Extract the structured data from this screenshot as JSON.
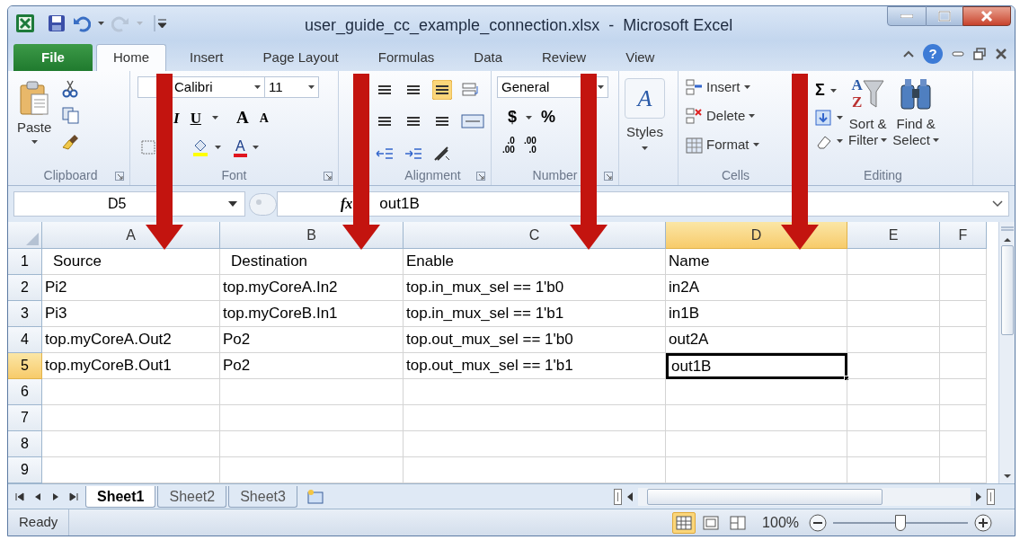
{
  "window": {
    "title": "user_guide_cc_example_connection.xlsx  -  Microsoft Excel"
  },
  "tabs": [
    {
      "label": "File",
      "kind": "file",
      "selected": false
    },
    {
      "label": "Home",
      "kind": "tab",
      "selected": true
    },
    {
      "label": "Insert",
      "kind": "tab",
      "selected": false
    },
    {
      "label": "Page Layout",
      "kind": "tab",
      "selected": false
    },
    {
      "label": "Formulas",
      "kind": "tab",
      "selected": false
    },
    {
      "label": "Data",
      "kind": "tab",
      "selected": false
    },
    {
      "label": "Review",
      "kind": "tab",
      "selected": false
    },
    {
      "label": "View",
      "kind": "tab",
      "selected": false
    }
  ],
  "ribbon": {
    "clipboard": {
      "paste": "Paste",
      "label": "Clipboard"
    },
    "help": "?",
    "font": {
      "name": "Calibri",
      "size": "11",
      "italic": "I",
      "underline": "U",
      "grow": "A",
      "shrink": "A",
      "color_glyph": "A",
      "label": "Font"
    },
    "alignment": {
      "label": "Alignment"
    },
    "number": {
      "format": "General",
      "currency": "$",
      "percent": "%",
      "increase": [
        ".0",
        ".00"
      ],
      "decrease": [
        ".00",
        ".0"
      ],
      "label": "Number"
    },
    "styles": {
      "glyph": "A",
      "label": "Styles"
    },
    "cells": {
      "items": [
        "Insert",
        "Delete",
        "Format"
      ],
      "label": "Cells"
    },
    "editing": {
      "sum": "Σ",
      "sort_glyphs": [
        "A",
        "Z"
      ],
      "sort": [
        "Sort &",
        "Filter"
      ],
      "find": [
        "Find &",
        "Select"
      ],
      "label": "Editing"
    }
  },
  "formula_bar": {
    "name_box": "D5",
    "fx": "fx",
    "formula": "out1B"
  },
  "sheet": {
    "columns": [
      {
        "label": "A",
        "selected": false
      },
      {
        "label": "B",
        "selected": false
      },
      {
        "label": "C",
        "selected": false
      },
      {
        "label": "D",
        "selected": true
      },
      {
        "label": "E",
        "selected": false
      },
      {
        "label": "F",
        "selected": false
      }
    ],
    "rows": [
      {
        "number": "1",
        "selected": false,
        "cells": [
          "Source",
          "Destination",
          "Enable",
          "Name"
        ]
      },
      {
        "number": "2",
        "selected": false,
        "cells": [
          "Pi2",
          "top.myCoreA.In2",
          "top.in_mux_sel == 1'b0",
          "in2A"
        ]
      },
      {
        "number": "3",
        "selected": false,
        "cells": [
          "Pi3",
          "top.myCoreB.In1",
          "top.in_mux_sel == 1'b1",
          "in1B"
        ]
      },
      {
        "number": "4",
        "selected": false,
        "cells": [
          "top.myCoreA.Out2",
          "Po2",
          "top.out_mux_sel == 1'b0",
          "out2A"
        ]
      },
      {
        "number": "5",
        "selected": true,
        "cells": [
          "top.myCoreB.Out1",
          "Po2",
          "top.out_mux_sel == 1'b1",
          "out1B"
        ]
      },
      {
        "number": "6",
        "selected": false,
        "cells": []
      },
      {
        "number": "7",
        "selected": false,
        "cells": []
      },
      {
        "number": "8",
        "selected": false,
        "cells": []
      },
      {
        "number": "9",
        "selected": false,
        "cells": []
      }
    ]
  },
  "sheet_tabs": [
    {
      "label": "Sheet1",
      "selected": true
    },
    {
      "label": "Sheet2",
      "selected": false
    },
    {
      "label": "Sheet3",
      "selected": false
    }
  ],
  "status_bar": {
    "status": "Ready",
    "views": [
      {
        "kind": "normal",
        "selected": true
      },
      {
        "kind": "layout",
        "selected": false
      },
      {
        "kind": "pagebreak",
        "selected": false
      }
    ],
    "zoom": "100%",
    "zoom_slider": {
      "level": 0.5
    }
  }
}
